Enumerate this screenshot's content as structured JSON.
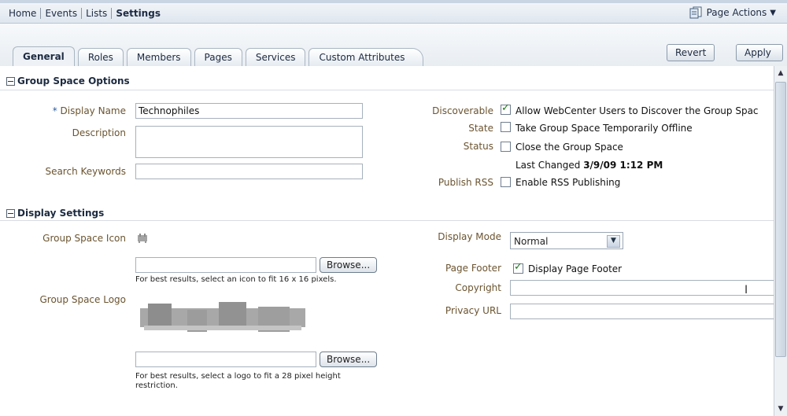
{
  "nav": {
    "items": [
      "Home",
      "Events",
      "Lists",
      "Settings"
    ],
    "page_actions": "Page Actions"
  },
  "tabs": [
    "General",
    "Roles",
    "Members",
    "Pages",
    "Services",
    "Custom Attributes"
  ],
  "buttons": {
    "revert": "Revert",
    "apply": "Apply"
  },
  "group_space_options": {
    "header": "Group Space Options",
    "display_name_label": "Display Name",
    "display_name_value": "Technophiles",
    "required_marker": "*",
    "description_label": "Description",
    "description_value": "",
    "search_keywords_label": "Search Keywords",
    "search_keywords_value": "",
    "discoverable_label": "Discoverable",
    "discoverable_text": "Allow WebCenter Users to Discover the Group Spac",
    "discoverable_checked": true,
    "state_label": "State",
    "state_text": "Take Group Space Temporarily Offline",
    "state_checked": false,
    "status_label": "Status",
    "status_text": "Close the Group Space",
    "status_checked": false,
    "last_changed_label": "Last Changed",
    "last_changed_value": "3/9/09 1:12 PM",
    "publish_rss_label": "Publish RSS",
    "publish_rss_text": "Enable RSS Publishing",
    "publish_rss_checked": false
  },
  "display_settings": {
    "header": "Display Settings",
    "icon_label": "Group Space Icon",
    "browse_label": "Browse...",
    "icon_hint": "For best results, select an icon to fit 16 x 16 pixels.",
    "logo_label": "Group Space Logo",
    "logo_hint_line1": "For best results, select a logo to fit a 28 pixel height",
    "logo_hint_line2": "restriction.",
    "display_mode_label": "Display Mode",
    "display_mode_value": "Normal",
    "page_footer_label": "Page Footer",
    "page_footer_text": "Display Page Footer",
    "page_footer_checked": true,
    "copyright_label": "Copyright",
    "copyright_value": "",
    "privacy_url_label": "Privacy URL",
    "privacy_url_value": ""
  }
}
